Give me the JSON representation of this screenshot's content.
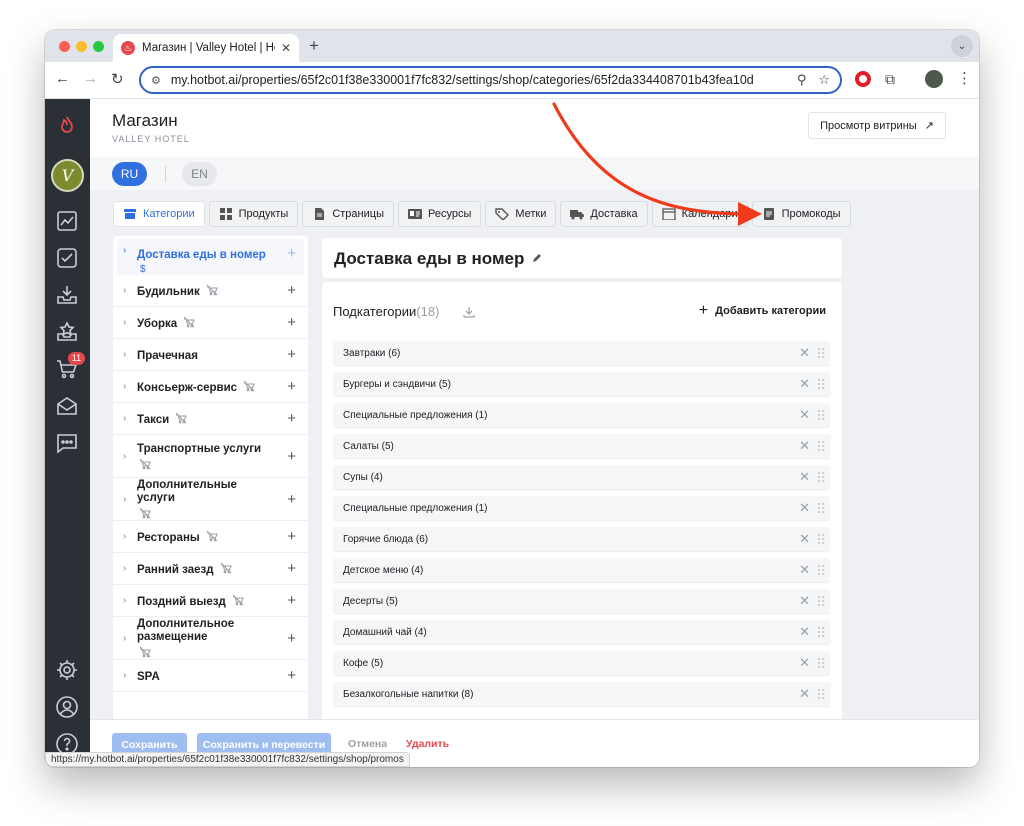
{
  "browser": {
    "tab_title": "Магазин | Valley Hotel | Hotbot",
    "url": "my.hotbot.ai/properties/65f2c01f38e330001f7fc832/settings/shop/categories/65f2da334408701b43fea10d",
    "status_url": "https://my.hotbot.ai/properties/65f2c01f38e330001f7fc832/settings/shop/promos"
  },
  "sidebar": {
    "avatar_letter": "V",
    "cart_badge": "11"
  },
  "header": {
    "title": "Магазин",
    "subtitle": "VALLEY HOTEL",
    "preview_label": "Просмотр витрины",
    "preview_icon": "↗"
  },
  "languages": {
    "ru": "RU",
    "en": "EN"
  },
  "tabs": [
    {
      "label": "Категории",
      "icon": "store-icon",
      "active": true
    },
    {
      "label": "Продукты",
      "icon": "grid-icon"
    },
    {
      "label": "Страницы",
      "icon": "page-icon"
    },
    {
      "label": "Ресурсы",
      "icon": "resource-icon"
    },
    {
      "label": "Метки",
      "icon": "tag-icon"
    },
    {
      "label": "Доставка",
      "icon": "truck-icon"
    },
    {
      "label": "Календари",
      "icon": "calendar-icon"
    },
    {
      "label": "Промокоды",
      "icon": "promo-icon"
    }
  ],
  "categories": [
    {
      "label": "Доставка еды в номер",
      "selected": true,
      "extra": "$"
    },
    {
      "label": "Будильник",
      "hidden": true
    },
    {
      "label": "Уборка",
      "hidden": true
    },
    {
      "label": "Прачечная"
    },
    {
      "label": "Консьерж-сервис",
      "hidden": true
    },
    {
      "label": "Такси",
      "hidden": true
    },
    {
      "label": "Транспортные услуги",
      "hidden": true,
      "wrap": true
    },
    {
      "label": "Дополнительные услуги",
      "hidden": true,
      "wrap": true
    },
    {
      "label": "Рестораны",
      "hidden": true
    },
    {
      "label": "Ранний заезд",
      "hidden": true
    },
    {
      "label": "Поздний выезд",
      "hidden": true
    },
    {
      "label": "Дополнительное размещение",
      "hidden": true,
      "wrap": true
    },
    {
      "label": "SPA"
    }
  ],
  "detail": {
    "title": "Доставка еды в номер",
    "subcategories_label": "Подкатегории",
    "subcategories_count": "(18)",
    "add_category_label": "Добавить категории",
    "subcategories": [
      "Завтраки (6)",
      "Бургеры и сэндвичи (5)",
      "Специальные предложения (1)",
      "Салаты (5)",
      "Супы (4)",
      "Специальные предложения (1)",
      "Горячие блюда (6)",
      "Детское меню (4)",
      "Десерты (5)",
      "Домашний чай (4)",
      "Кофе (5)",
      "Безалкогольные напитки (8)"
    ]
  },
  "footer": {
    "save": "Сохранить",
    "save_translate": "Сохранить и перевести",
    "cancel": "Отмена",
    "delete": "Удалить"
  },
  "colors": {
    "accent": "#2f6fe0",
    "sidebar": "#2b2f36",
    "danger": "#e5484d",
    "annotation_arrow": "#f03a1c"
  }
}
